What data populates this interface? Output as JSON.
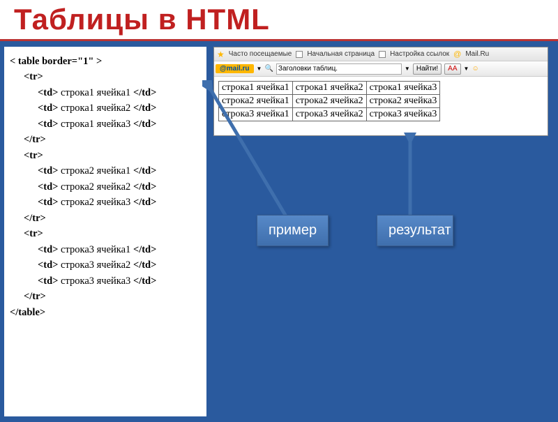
{
  "title": "Таблицы в HTML",
  "code": {
    "open_table": "< table border=\"1\" >",
    "tr_open": "<tr>",
    "tr_close": "</tr>",
    "table_close": "</table>",
    "td_open": "<td>",
    "td_close": "</td>",
    "rows": [
      [
        "строка1 ячейка1",
        "строка1 ячейка2",
        "строка1 ячейка3"
      ],
      [
        "строка2 ячейка1",
        "строка2 ячейка2",
        "строка2 ячейка3"
      ],
      [
        "строка3 ячейка1",
        "строка3 ячейка2",
        "строка3 ячейка3"
      ]
    ]
  },
  "toolbar": {
    "frequently_visited": "Часто посещаемые",
    "start_page": "Начальная страница",
    "link_settings": "Настройка ссылок",
    "mailru": "Mail.Ru",
    "logo": "@mail.ru",
    "search_value": "Заголовки таблиц.",
    "find_btn": "Найти!",
    "aa": "AA"
  },
  "result_table": [
    [
      "строка1 ячейка1",
      "строка1 ячейка2",
      "строка1 ячейка3"
    ],
    [
      "строка2 ячейка1",
      "строка2 ячейка2",
      "строка2 ячейка3"
    ],
    [
      "строка3 ячейка1",
      "строка3 ячейка2",
      "строка3 ячейка3"
    ]
  ],
  "labels": {
    "example": "пример",
    "result": "результат"
  }
}
